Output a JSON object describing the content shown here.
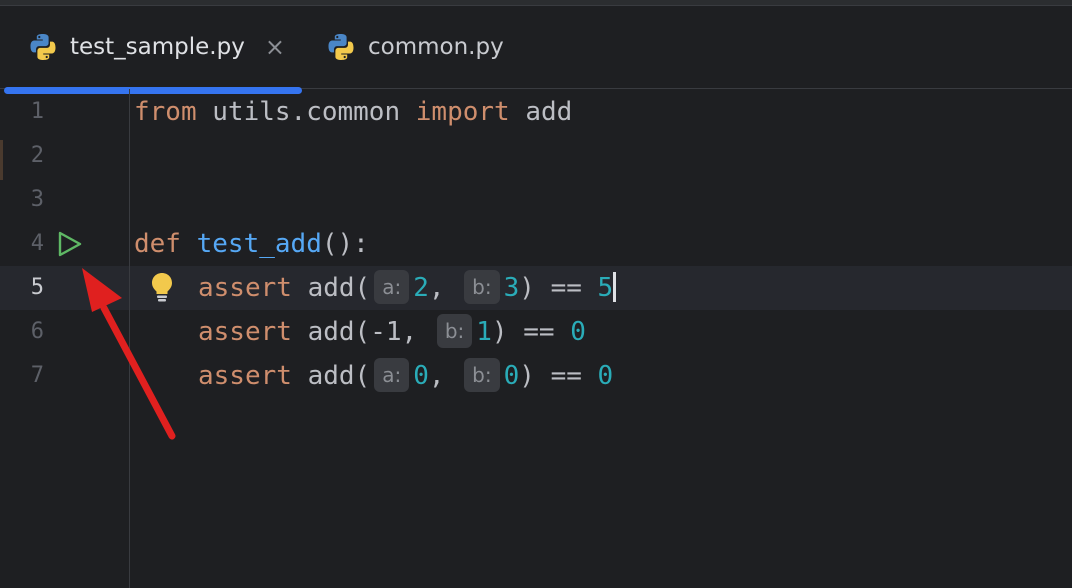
{
  "tabs": [
    {
      "label": "test_sample.py",
      "icon": "python-icon",
      "active": true,
      "close": "×"
    },
    {
      "label": "common.py",
      "icon": "python-icon",
      "active": false
    }
  ],
  "editor": {
    "line_numbers": [
      "1",
      "2",
      "3",
      "4",
      "5",
      "6",
      "7"
    ],
    "current_line": "5",
    "lines": {
      "l1": {
        "kw1": "from",
        "mod": " utils.common ",
        "kw2": "import",
        "name": " add"
      },
      "l4": {
        "kw": "def",
        "fn": " test_add",
        "rest": "():"
      },
      "l5": {
        "kw": "assert",
        "call": " add(",
        "hint_a": "a:",
        "a": "2",
        "sep": ", ",
        "hint_b": "b:",
        "b": "3",
        "close": ") == ",
        "result": "5"
      },
      "l6": {
        "kw": "assert",
        "call": " add(",
        "a": "-1",
        "sep": ", ",
        "hint_b": "b:",
        "b": "1",
        "close": ") == ",
        "result": "0"
      },
      "l7": {
        "kw": "assert",
        "call": " add(",
        "hint_a": "a:",
        "a": "0",
        "sep": ", ",
        "hint_b": "b:",
        "b": "0",
        "close": ") == ",
        "result": "0"
      }
    }
  },
  "colors": {
    "background": "#1e1f22",
    "keyword": "#cf8e6d",
    "function": "#56a8f5",
    "number": "#2aacb8",
    "accent": "#3574f0",
    "run_green": "#5fb865",
    "annotation_arrow": "#e0201f"
  }
}
